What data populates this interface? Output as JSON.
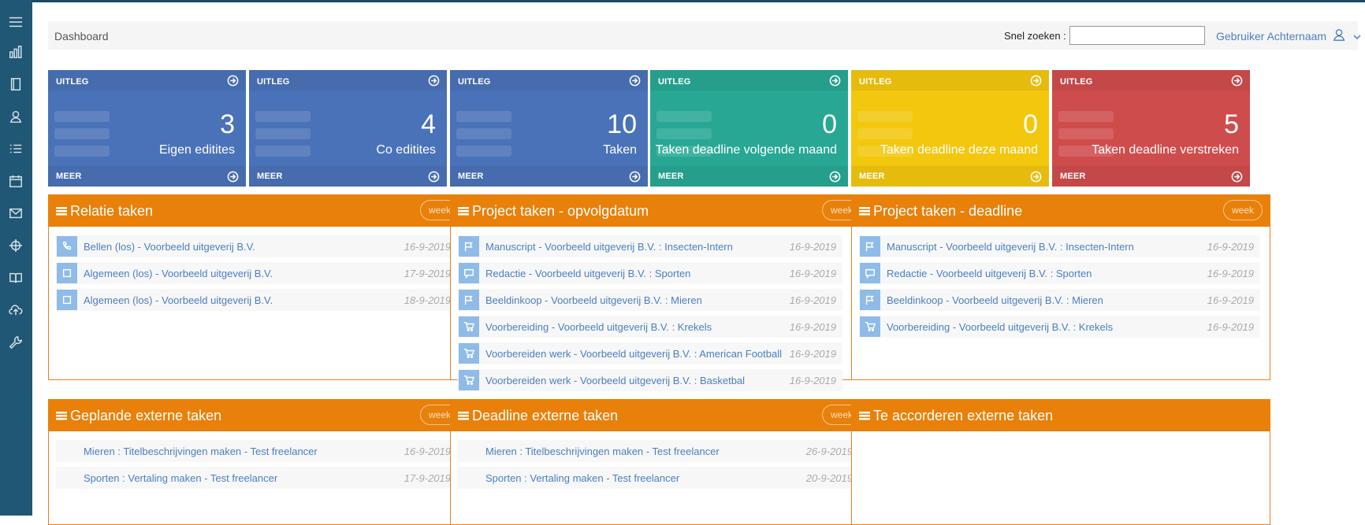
{
  "header": {
    "breadcrumb": "Dashboard",
    "search_label": "Snel zoeken :",
    "search_value": "",
    "user_name": "Gebruiker Achternaam"
  },
  "sidebar": {
    "icons": [
      "menu-icon",
      "bar-chart-icon",
      "book-icon",
      "contacts-icon",
      "list-icon",
      "calendar-icon",
      "mail-icon",
      "crosshair-icon",
      "open-book-icon",
      "cloud-upload-icon",
      "wrench-icon"
    ]
  },
  "stats": [
    {
      "top_label": "UITLEG",
      "bottom_label": "MEER",
      "number": "3",
      "caption": "Eigen editites",
      "color": "#4a72b8"
    },
    {
      "top_label": "UITLEG",
      "bottom_label": "MEER",
      "number": "4",
      "caption": "Co editites",
      "color": "#4a72b8"
    },
    {
      "top_label": "UITLEG",
      "bottom_label": "MEER",
      "number": "10",
      "caption": "Taken",
      "color": "#4a72b8"
    },
    {
      "top_label": "UITLEG",
      "bottom_label": "MEER",
      "number": "0",
      "caption": "Taken deadline volgende maand",
      "color": "#27a794"
    },
    {
      "top_label": "UITLEG",
      "bottom_label": "MEER",
      "number": "0",
      "caption": "Taken deadline deze maand",
      "color": "#f2c70e"
    },
    {
      "top_label": "UITLEG",
      "bottom_label": "MEER",
      "number": "5",
      "caption": "Taken deadline verstreken",
      "color": "#cf4c4c"
    }
  ],
  "panels": [
    {
      "title": "Relatie taken",
      "week": "week",
      "rows": [
        {
          "icon": "phone-icon",
          "text": "Bellen (los) - Voorbeeld uitgeverij B.V.",
          "date": "16-9-2019"
        },
        {
          "icon": "square-icon",
          "text": "Algemeen (los) - Voorbeeld uitgeverij B.V.",
          "date": "17-9-2019"
        },
        {
          "icon": "square-icon",
          "text": "Algemeen (los) - Voorbeeld uitgeverij B.V.",
          "date": "18-9-2019"
        }
      ]
    },
    {
      "title": "Project taken - opvolgdatum",
      "week": "week",
      "rows": [
        {
          "icon": "flag-icon",
          "text": "Manuscript - Voorbeeld uitgeverij B.V. : Insecten-Intern",
          "date": "16-9-2019"
        },
        {
          "icon": "chat-icon",
          "text": "Redactie - Voorbeeld uitgeverij B.V. : Sporten",
          "date": "16-9-2019"
        },
        {
          "icon": "flag-icon",
          "text": "Beeldinkoop - Voorbeeld uitgeverij B.V. : Mieren",
          "date": "16-9-2019"
        },
        {
          "icon": "cart-icon",
          "text": "Voorbereiding - Voorbeeld uitgeverij B.V. : Krekels",
          "date": "16-9-2019"
        },
        {
          "icon": "cart-icon",
          "text": "Voorbereiden werk - Voorbeeld uitgeverij B.V. : American Football",
          "date": "16-9-2019"
        },
        {
          "icon": "cart-icon",
          "text": "Voorbereiden werk - Voorbeeld uitgeverij B.V. : Basketbal",
          "date": "16-9-2019"
        }
      ]
    },
    {
      "title": "Project taken - deadline",
      "week": "week",
      "rows": [
        {
          "icon": "flag-icon",
          "text": "Manuscript - Voorbeeld uitgeverij B.V. : Insecten-Intern",
          "date": "16-9-2019"
        },
        {
          "icon": "chat-icon",
          "text": "Redactie - Voorbeeld uitgeverij B.V. : Sporten",
          "date": "16-9-2019"
        },
        {
          "icon": "flag-icon",
          "text": "Beeldinkoop - Voorbeeld uitgeverij B.V. : Mieren",
          "date": "16-9-2019"
        },
        {
          "icon": "cart-icon",
          "text": "Voorbereiding - Voorbeeld uitgeverij B.V. : Krekels",
          "date": "16-9-2019"
        }
      ]
    },
    {
      "title": "Geplande externe taken",
      "week": "week",
      "rows": [
        {
          "icon": "",
          "text": "Mieren : Titelbeschrijvingen maken - Test freelancer",
          "date": "16-9-2019"
        },
        {
          "icon": "",
          "text": "Sporten : Vertaling maken - Test freelancer",
          "date": "17-9-2019"
        }
      ]
    },
    {
      "title": "Deadline externe taken",
      "week": "week",
      "rows": [
        {
          "icon": "",
          "text": "Mieren : Titelbeschrijvingen maken - Test freelancer",
          "date": "26-9-2019"
        },
        {
          "icon": "",
          "text": "Sporten : Vertaling maken - Test freelancer",
          "date": "20-9-2019"
        }
      ]
    },
    {
      "title": "Te accorderen externe taken",
      "week": "",
      "rows": []
    }
  ]
}
